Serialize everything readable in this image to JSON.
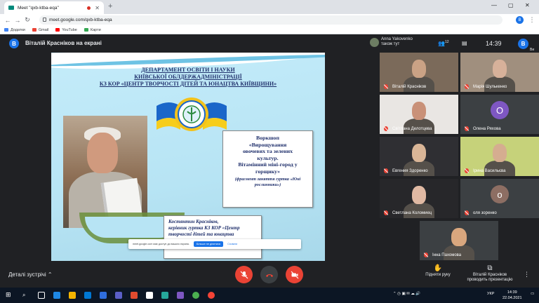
{
  "browser": {
    "tab_title": "Meet \"qxb-ktba-eqa\"",
    "url": "meet.google.com/qxb-ktba-eqa",
    "new_tab": "+",
    "profile_initial": "B",
    "bookmarks": [
      {
        "label": "Додатки",
        "color": "#4285f4"
      },
      {
        "label": "Gmail",
        "color": "#ea4335"
      },
      {
        "label": "YouTube",
        "color": "#ff0000"
      },
      {
        "label": "Карти",
        "color": "#34a853"
      }
    ]
  },
  "meet": {
    "presenter_initial": "В",
    "presenter_title": "Віталій Красніков на екрані",
    "speaker_name": "Anna Yakovenko",
    "speaker_sub": "також тут",
    "participants_count": "12",
    "time": "14:39",
    "me_initial": "В",
    "me_label": "Ви"
  },
  "slide": {
    "header": [
      "ДЕПАРТАМЕНТ ОСВІТИ І НАУКИ",
      "КИЇВСЬКОЇ ОБЛДЕРЖАДМІНІСТРАЦІЇ",
      "КЗ КОР  «ЦЕНТР ТВОРЧОСТІ ДІТЕЙ ТА ЮНАЦТВА КИЇВЩИНИ»"
    ],
    "box_lines": [
      "Воркшоп",
      "«Вирощування",
      "овочевих та зелених",
      "культур.",
      "Вітамінний міні-город у",
      "горщику»"
    ],
    "box_small": "(фрагмент заняття гуртка «Юні рослинники»)",
    "author_lines": [
      "Костянтин Красніков,",
      "керівник гуртка КЗ КОР «Центр",
      "творчості дітей та юнацтва"
    ],
    "share_notice": "meet.google.com має доступ до вашого екрана.",
    "share_stop": "Більше не ділитися",
    "share_hide": "Сховати"
  },
  "participants": [
    {
      "name": "Віталій Красніков",
      "kind": "video",
      "muted": true,
      "bg": "#7b6a5a",
      "skin": "#caa285"
    },
    {
      "name": "Марія Шулькенко",
      "kind": "video",
      "muted": true,
      "bg": "#a08f7e",
      "skin": "#d7b19a"
    },
    {
      "name": "Світлана Делотцева",
      "kind": "video",
      "muted": true,
      "bg": "#e9e6e3",
      "skin": "#c99178"
    },
    {
      "name": "Олена Ряхова",
      "kind": "avatar",
      "muted": true,
      "initial": "О",
      "color": "#7e57c2"
    },
    {
      "name": "Евгения Здоренко",
      "kind": "video",
      "muted": true,
      "bg": "#2f2f33",
      "skin": "#d9b597"
    },
    {
      "name": "Ірина Васильєва",
      "kind": "video",
      "muted": true,
      "bg": "#c6d27a",
      "skin": "#d5ad90"
    },
    {
      "name": "Светлана Коломиец",
      "kind": "video",
      "muted": true,
      "bg": "#27272a",
      "skin": "#e0b9a3"
    },
    {
      "name": "оля зоренко",
      "kind": "avatar",
      "muted": true,
      "initial": "о",
      "color": "#8d6e63"
    },
    {
      "name": "Інна Пахомова",
      "kind": "photo",
      "muted": true,
      "bg": "#3c4043",
      "skin": "#d9a77e"
    }
  ],
  "bottom": {
    "details": "Деталі зустрічі",
    "raise_hand": "Підняти руку",
    "presenting": [
      "Віталій Красніков",
      "проводить презентацію"
    ]
  },
  "taskbar": {
    "lang": "УКР",
    "time": "14:39",
    "date": "22.04.2021"
  },
  "colors": {
    "red": "#ea4335",
    "blue": "#1a73e8",
    "bg": "#202124"
  }
}
